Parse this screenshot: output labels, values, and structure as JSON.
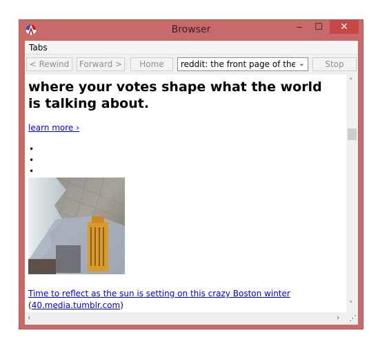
{
  "window": {
    "title": "Browser",
    "minimize_glyph": "‒",
    "maximize_glyph": "☐",
    "close_glyph": "✕",
    "app_icon": "racket-logo-icon"
  },
  "menu": {
    "tabs_label": "Tabs"
  },
  "toolbar": {
    "rewind_label": "< Rewind",
    "forward_label": "Forward >",
    "home_label": "Home",
    "stop_label": "Stop",
    "page_select_value": "reddit: the front page of the internet"
  },
  "content": {
    "headline": "where your votes shape what the world is talking about.",
    "learn_more": "learn more ›",
    "bullets": [
      "•",
      "•",
      "•"
    ],
    "post_title": "Time to reflect as the sun is setting on this crazy Boston winter",
    "post_domain_open": "(",
    "post_domain": "40.media.tumblr.com",
    "post_domain_close": ")"
  },
  "scrollbars": {
    "up_arrow": "˄",
    "down_arrow": "˅",
    "left_arrow": "‹",
    "right_arrow": "›",
    "grip": "⋰"
  },
  "colors": {
    "frame": "#c86a6a",
    "close_button": "#c74646",
    "link": "#0000cc"
  }
}
